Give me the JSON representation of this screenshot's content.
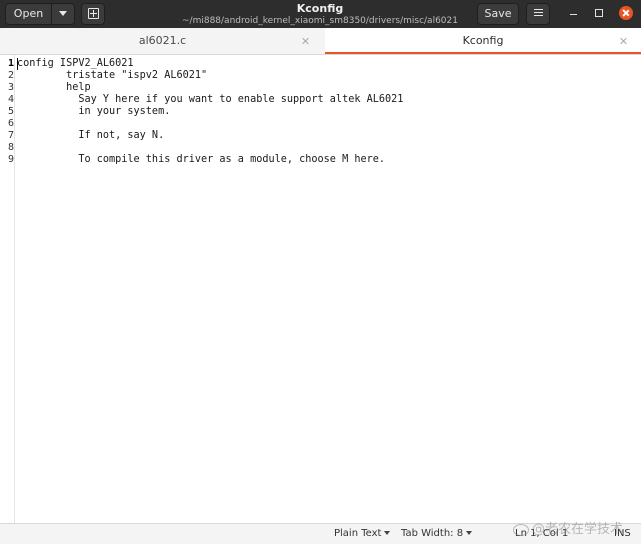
{
  "header": {
    "open_label": "Open",
    "save_label": "Save",
    "title": "Kconfig",
    "subtitle": "~/mi888/android_kernel_xiaomi_sm8350/drivers/misc/al6021"
  },
  "tabs": [
    {
      "label": "al6021.c",
      "active": false
    },
    {
      "label": "Kconfig",
      "active": true
    }
  ],
  "editor": {
    "current_line": 1,
    "lines": [
      {
        "num": "1",
        "text": "config ISPV2_AL6021"
      },
      {
        "num": "2",
        "text": "        tristate \"ispv2 AL6021\""
      },
      {
        "num": "3",
        "text": "        help"
      },
      {
        "num": "4",
        "text": "          Say Y here if you want to enable support altek AL6021"
      },
      {
        "num": "5",
        "text": "          in your system."
      },
      {
        "num": "6",
        "text": ""
      },
      {
        "num": "7",
        "text": "          If not, say N."
      },
      {
        "num": "8",
        "text": ""
      },
      {
        "num": "9",
        "text": "          To compile this driver as a module, choose M here."
      }
    ]
  },
  "statusbar": {
    "language": "Plain Text",
    "tab_width": "Tab Width: 8",
    "position": "Ln 1, Col 1",
    "mode": "INS"
  },
  "watermark": "@老农在学技术",
  "colors": {
    "accent": "#e95420",
    "header_bg": "#2d2d2d"
  },
  "icons": {
    "open_menu": "chevron-down-icon",
    "new_tab": "new-tab-icon",
    "menu": "hamburger-menu-icon",
    "minimize": "minimize-icon",
    "maximize": "maximize-icon",
    "close": "close-icon"
  }
}
